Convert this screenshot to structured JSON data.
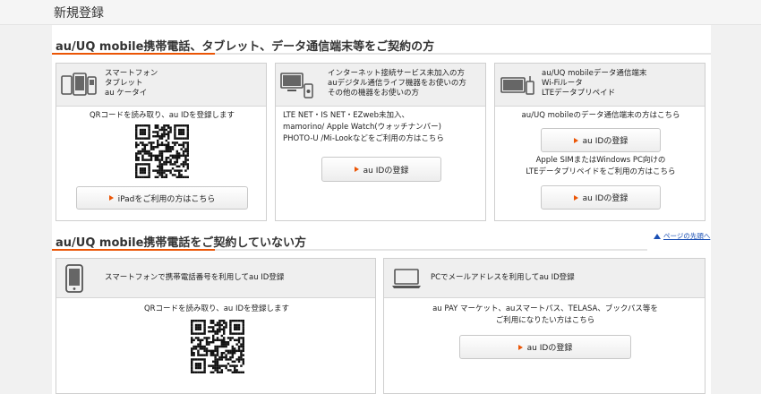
{
  "header": {
    "title": "新規登録"
  },
  "section1": {
    "title": "au/UQ mobile携帯電話、タブレット、データ通信端末等をご契約の方",
    "cards": [
      {
        "heading": [
          "スマートフォン",
          "タブレット",
          "au ケータイ"
        ],
        "body": "QRコードを読み取り、au IDを登録します",
        "button": "iPadをご利用の方はこちら"
      },
      {
        "heading": [
          "インターネット接続サービス未加入の方",
          "auデジタル通信ライフ機器をお使いの方",
          "その他の機器をお使いの方"
        ],
        "body": [
          "LTE NET・IS NET・EZweb未加入、",
          "mamorino/ Apple Watch(ウォッチナンバー)",
          "PHOTO-U /Mi-Lookなどをご利用の方はこちら"
        ],
        "button": "au IDの登録"
      },
      {
        "heading": [
          "au/UQ mobileデータ通信端末",
          "Wi-Fiルータ",
          "LTEデータプリペイド"
        ],
        "body": "au/UQ mobileのデータ通信端末の方はこちら",
        "button1": "au IDの登録",
        "body2": [
          "Apple SIMまたはWindows PC向けの",
          "LTEデータプリペイドをご利用の方はこちら"
        ],
        "button2": "au IDの登録"
      }
    ]
  },
  "section2": {
    "title": "au/UQ mobile携帯電話をご契約していない方",
    "pagetop": "ページの先頭へ",
    "cards": [
      {
        "heading": "スマートフォンで携帯電話番号を利用してau ID登録",
        "body": "QRコードを読み取り、au IDを登録します"
      },
      {
        "heading": "PCでメールアドレスを利用してau ID登録",
        "body": [
          "au PAY マーケット、auスマートパス、TELASA、ブックパス等を",
          "ご利用になりたい方はこちら"
        ],
        "button": "au IDの登録"
      }
    ]
  },
  "icons": {
    "devices": "smartphone-tablet-phone-icon",
    "pc_router": "pc-router-icon",
    "router": "data-router-icon",
    "smartphone": "smartphone-icon",
    "laptop": "laptop-icon",
    "qr": "qr-code"
  },
  "colors": {
    "accent": "#eb5505",
    "link": "#1a4fb4",
    "card_head_bg": "#efefef"
  }
}
